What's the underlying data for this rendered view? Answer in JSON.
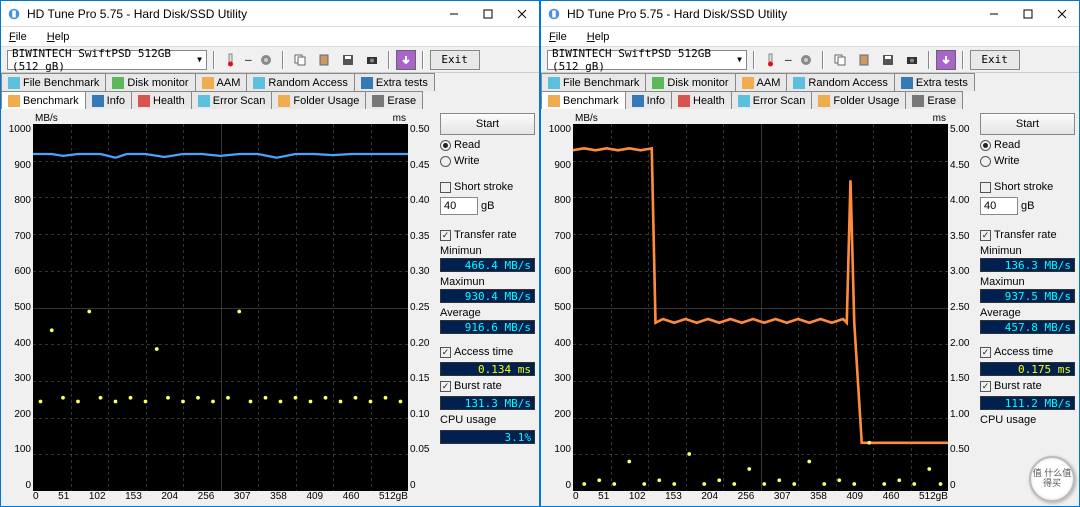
{
  "title": "HD Tune Pro 5.75 - Hard Disk/SSD Utility",
  "menu": {
    "file": "File",
    "help": "Help"
  },
  "drive": "BIWINTECH SwiftPSD 512GB (512 gB)",
  "exit": "Exit",
  "tabs_row1": [
    {
      "label": "File Benchmark",
      "icon": "#5bc0de"
    },
    {
      "label": "Disk monitor",
      "icon": "#5cb85c"
    },
    {
      "label": "AAM",
      "icon": "#f0ad4e"
    },
    {
      "label": "Random Access",
      "icon": "#5bc0de"
    },
    {
      "label": "Extra tests",
      "icon": "#337ab7"
    }
  ],
  "tabs_row2": [
    {
      "label": "Benchmark",
      "icon": "#f0ad4e"
    },
    {
      "label": "Info",
      "icon": "#337ab7"
    },
    {
      "label": "Health",
      "icon": "#d9534f"
    },
    {
      "label": "Error Scan",
      "icon": "#5bc0de"
    },
    {
      "label": "Folder Usage",
      "icon": "#f0ad4e"
    },
    {
      "label": "Erase",
      "icon": "#777"
    }
  ],
  "chart_data": [
    {
      "type": "line",
      "title": "MB/s vs ms",
      "xlabel": "gB",
      "ylabel_left": "MB/s",
      "ylabel_right": "ms",
      "ylim_left": [
        0,
        1000
      ],
      "ylim_right": [
        0,
        0.5
      ],
      "x_ticks": [
        0,
        51,
        102,
        153,
        204,
        256,
        307,
        358,
        409,
        460,
        "512gB"
      ],
      "y_left_ticks": [
        1000,
        900,
        800,
        700,
        600,
        500,
        400,
        300,
        200,
        100,
        0
      ],
      "y_right_ticks": [
        "0.50",
        "0.45",
        "0.40",
        "0.35",
        "0.30",
        "0.25",
        "0.20",
        "0.15",
        "0.10",
        "0.05",
        "0"
      ],
      "series": [
        {
          "name": "Transfer rate (MB/s)",
          "color": "#4aa3ff",
          "values_approx": "≈920 across full range with minor dips to ≈870"
        },
        {
          "name": "Access time (ms)",
          "color": "#ffff66",
          "values_approx": "scattered ≈0.10–0.18 ms, dense band near 0.13"
        }
      ]
    },
    {
      "type": "line",
      "title": "MB/s vs ms",
      "xlabel": "gB",
      "ylabel_left": "MB/s",
      "ylabel_right": "ms",
      "ylim_left": [
        0,
        1000
      ],
      "ylim_right": [
        0,
        5.0
      ],
      "x_ticks": [
        0,
        51,
        102,
        153,
        204,
        256,
        307,
        358,
        409,
        460,
        "512gB"
      ],
      "y_left_ticks": [
        1000,
        900,
        800,
        700,
        600,
        500,
        400,
        300,
        200,
        100,
        0
      ],
      "y_right_ticks": [
        "5.00",
        "4.50",
        "4.00",
        "3.50",
        "3.00",
        "2.50",
        "2.00",
        "1.50",
        "1.00",
        "0.50",
        "0"
      ],
      "series": [
        {
          "name": "Transfer rate (MB/s)",
          "color": "#ff8c3c",
          "segments": [
            {
              "range_gB": [
                0,
                110
              ],
              "value": 935
            },
            {
              "range_gB": [
                110,
                370
              ],
              "value": 470
            },
            {
              "range_gB": [
                370,
                395
              ],
              "value": 850,
              "note": "brief spike"
            },
            {
              "range_gB": [
                395,
                512
              ],
              "value": 150
            }
          ]
        },
        {
          "name": "Access time (ms)",
          "color": "#ffff66",
          "values_approx": "scattered ≈0.10–1.0 ms, dense band near 0.15–0.25"
        }
      ]
    }
  ],
  "start": "Start",
  "read": "Read",
  "write": "Write",
  "short_stroke": "Short stroke",
  "stroke_val": "40",
  "stroke_unit": "gB",
  "transfer_rate": "Transfer rate",
  "minimum": "Minimun",
  "maximum": "Maximun",
  "average": "Average",
  "access_time": "Access time",
  "burst_rate": "Burst rate",
  "cpu_usage": "CPU usage",
  "left": {
    "min": "466.4 MB/s",
    "max": "930.4 MB/s",
    "avg": "916.6 MB/s",
    "access": "0.134 ms",
    "burst": "131.3 MB/s",
    "cpu": "3.1%"
  },
  "right": {
    "min": "136.3 MB/s",
    "max": "937.5 MB/s",
    "avg": "457.8 MB/s",
    "access": "0.175 ms",
    "burst": "111.2 MB/s",
    "cpu": "",
    "cpu_label": "CPU usage"
  },
  "axis_label_mbs": "MB/s",
  "axis_label_ms": "ms",
  "watermark": "值 什么值得买"
}
